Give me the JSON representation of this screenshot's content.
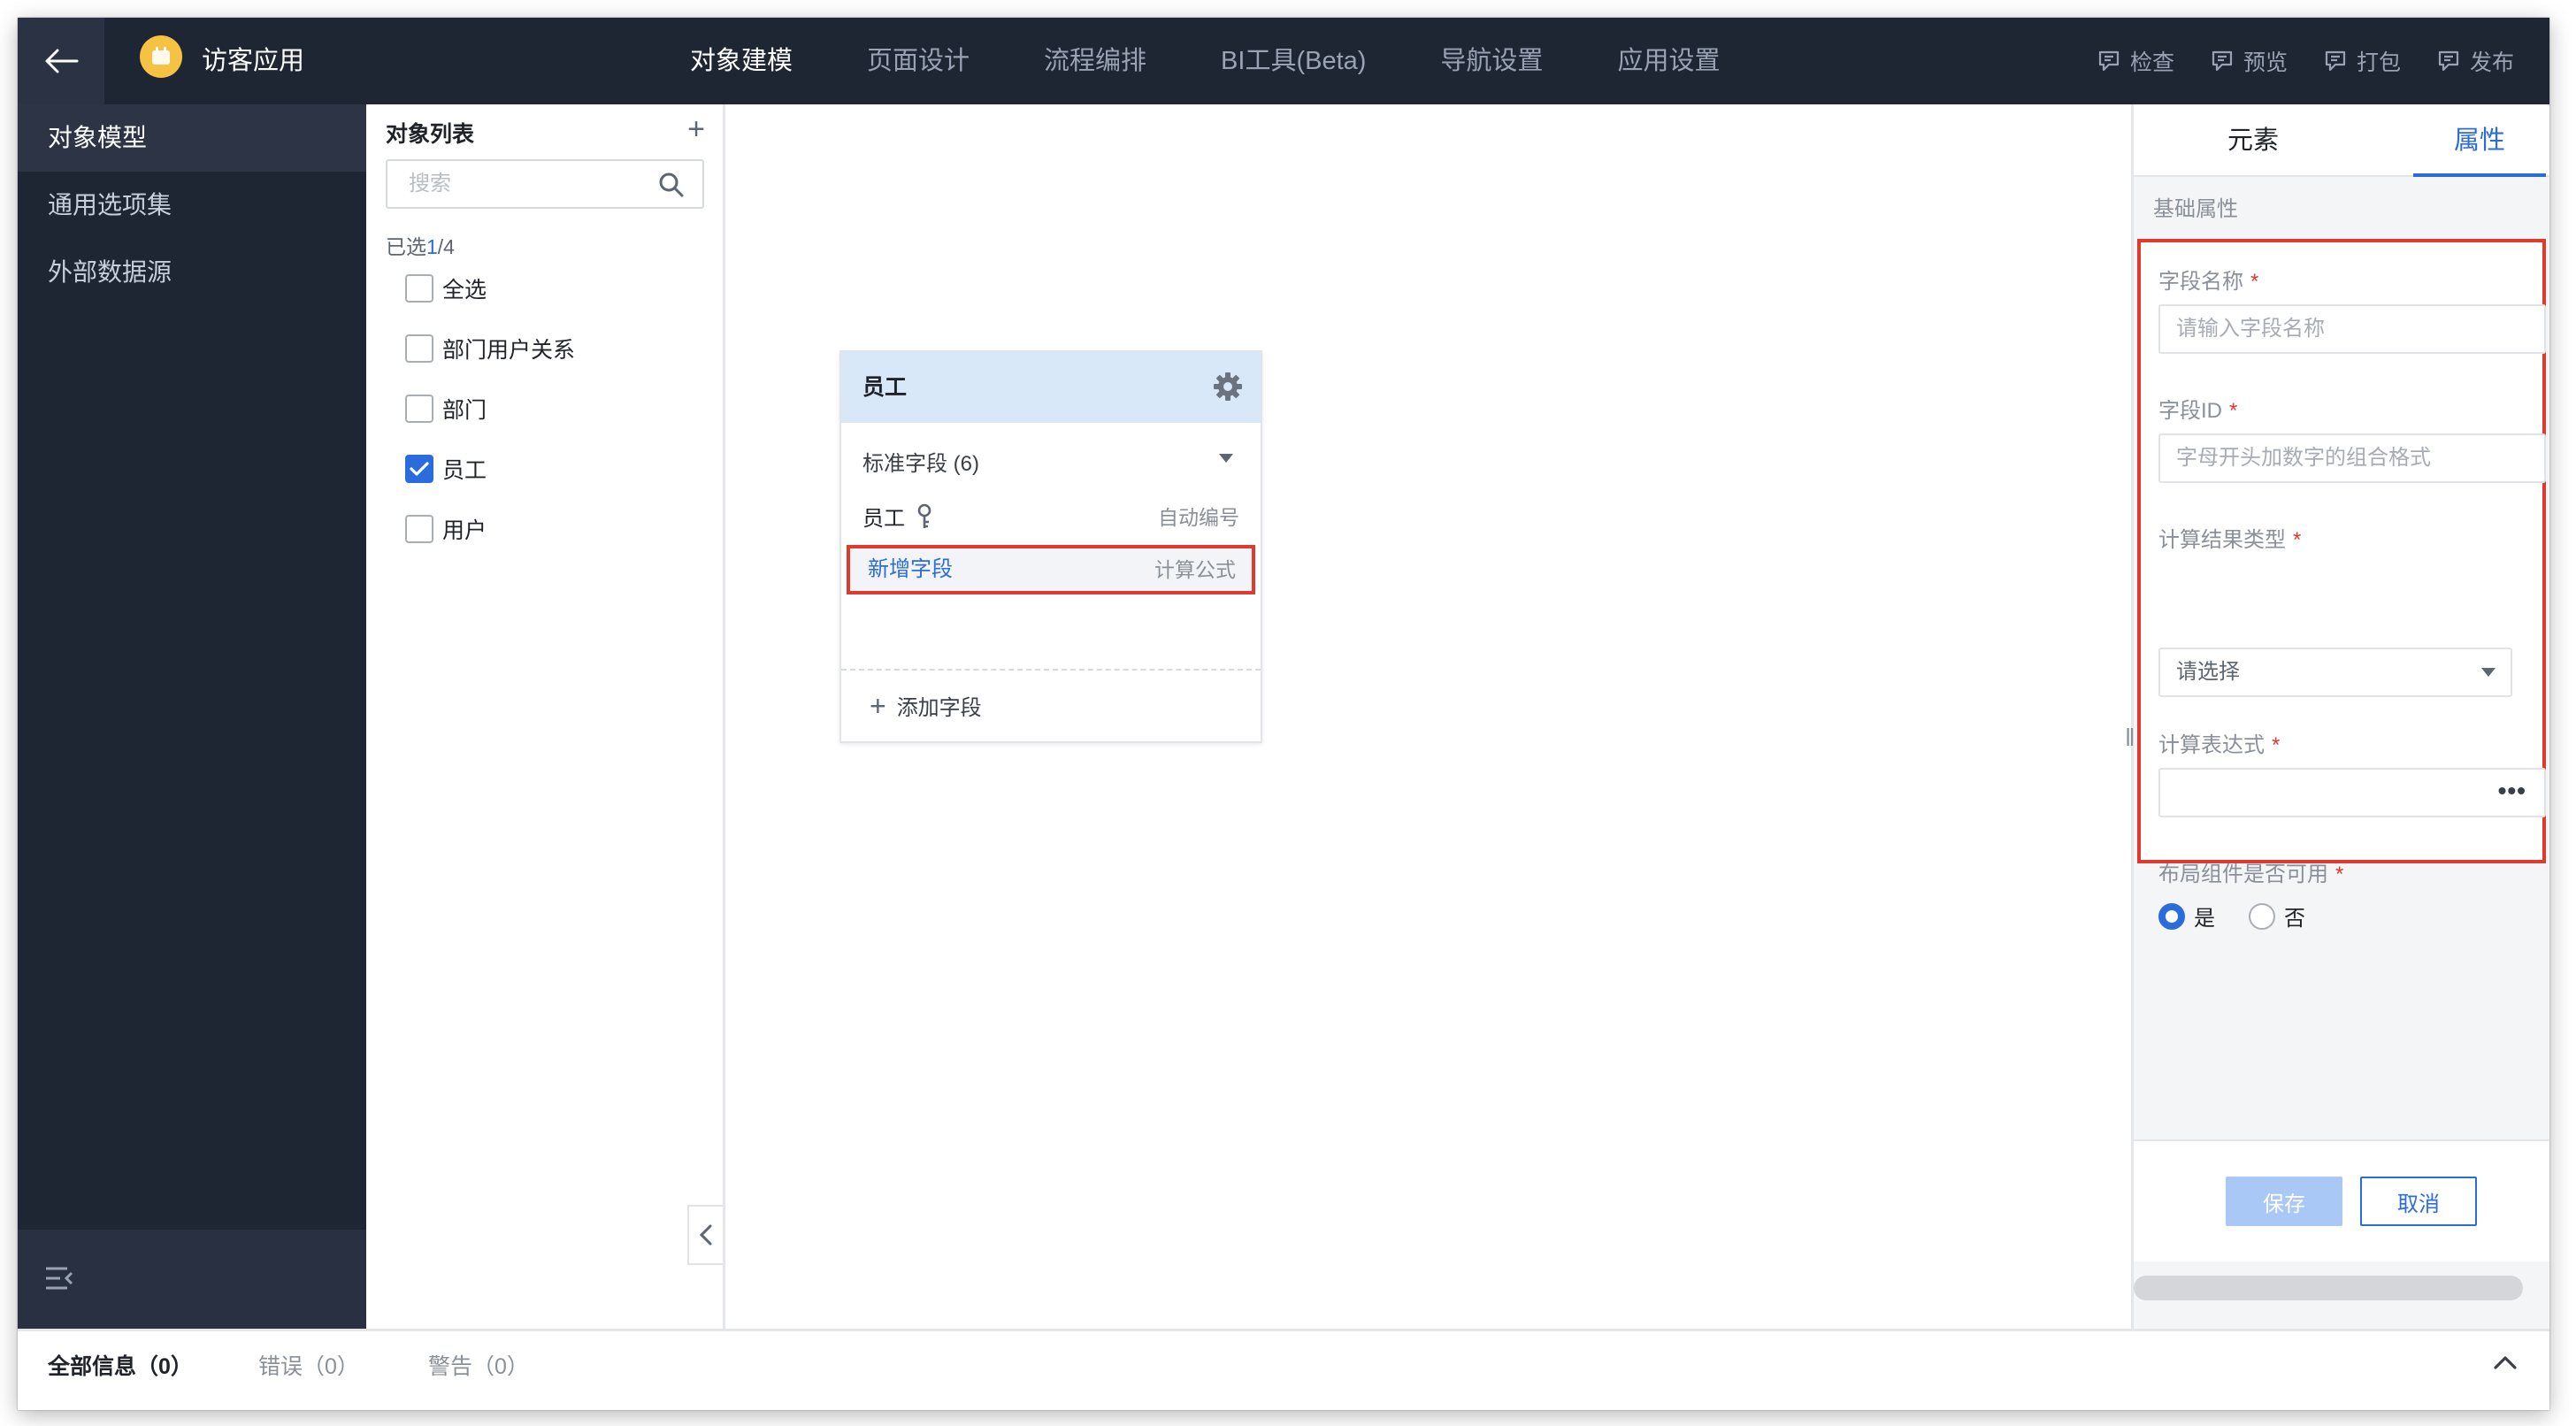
{
  "header": {
    "app_name": "访客应用",
    "nav": [
      "对象建模",
      "页面设计",
      "流程编排",
      "BI工具(Beta)",
      "导航设置",
      "应用设置"
    ],
    "active_nav": "对象建模",
    "tools": [
      "检查",
      "预览",
      "打包",
      "发布"
    ]
  },
  "sidebar": {
    "items": [
      "对象模型",
      "通用选项集",
      "外部数据源"
    ],
    "active": "对象模型"
  },
  "object_list": {
    "title": "对象列表",
    "search_placeholder": "搜索",
    "selected_prefix": "已选",
    "selected_count": "1",
    "selected_total": "/4",
    "items": [
      {
        "label": "全选",
        "checked": false
      },
      {
        "label": "部门用户关系",
        "checked": false
      },
      {
        "label": "部门",
        "checked": false
      },
      {
        "label": "员工",
        "checked": true
      },
      {
        "label": "用户",
        "checked": false
      }
    ]
  },
  "entity": {
    "title": "员工",
    "std_fields": "标准字段 (6)",
    "field1_name": "员工",
    "field1_type": "自动编号",
    "new_field_name": "新增字段",
    "new_field_type": "计算公式",
    "add_field": "添加字段"
  },
  "props": {
    "tab_elements": "元素",
    "tab_props": "属性",
    "section": "基础属性",
    "field_name_label": "字段名称",
    "field_name_placeholder": "请输入字段名称",
    "field_id_label": "字段ID",
    "field_id_placeholder": "字母开头加数字的组合格式",
    "result_type_label": "计算结果类型",
    "result_type_placeholder": "请选择",
    "expr_label": "计算表达式",
    "expr_more": "•••",
    "layout_label": "布局组件是否可用",
    "radio_yes": "是",
    "radio_no": "否",
    "required_mark": "*",
    "save": "保存",
    "cancel": "取消"
  },
  "bottom": {
    "tabs": [
      "全部信息（0）",
      "错误（0）",
      "警告（0）"
    ]
  },
  "colors": {
    "accent": "#2b6cdd",
    "highlight_border": "#e03a2e",
    "dark_bg": "#1f2633"
  }
}
